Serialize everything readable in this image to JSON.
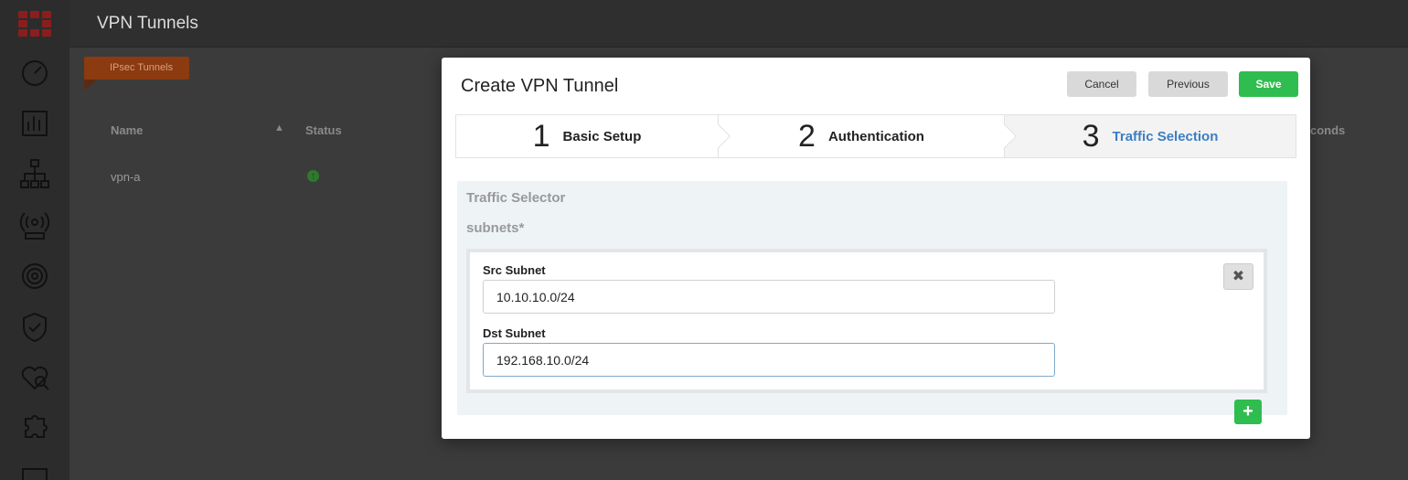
{
  "app": {
    "page_title": "VPN Tunnels",
    "tab_label": "IPsec Tunnels"
  },
  "table": {
    "columns": [
      "Name",
      "Status"
    ],
    "right_column_fragment": "conds",
    "rows": [
      {
        "name": "vpn-a",
        "status": "up"
      }
    ]
  },
  "modal": {
    "title": "Create VPN Tunnel",
    "cancel_label": "Cancel",
    "previous_label": "Previous",
    "save_label": "Save",
    "steps": [
      {
        "number": "1",
        "label": "Basic Setup"
      },
      {
        "number": "2",
        "label": "Authentication"
      },
      {
        "number": "3",
        "label": "Traffic Selection",
        "active": true
      }
    ],
    "section_title": "Traffic Selector",
    "subnets_label": "subnets*",
    "src_label": "Src Subnet",
    "src_value": "10.10.10.0/24",
    "dst_label": "Dst Subnet",
    "dst_value": "192.168.10.0/24",
    "remove_icon": "✖",
    "add_icon": "+"
  },
  "colors": {
    "save": "#2ebd4e",
    "active_step": "#3a7ec2",
    "tab_badge": "#8c3a10"
  }
}
